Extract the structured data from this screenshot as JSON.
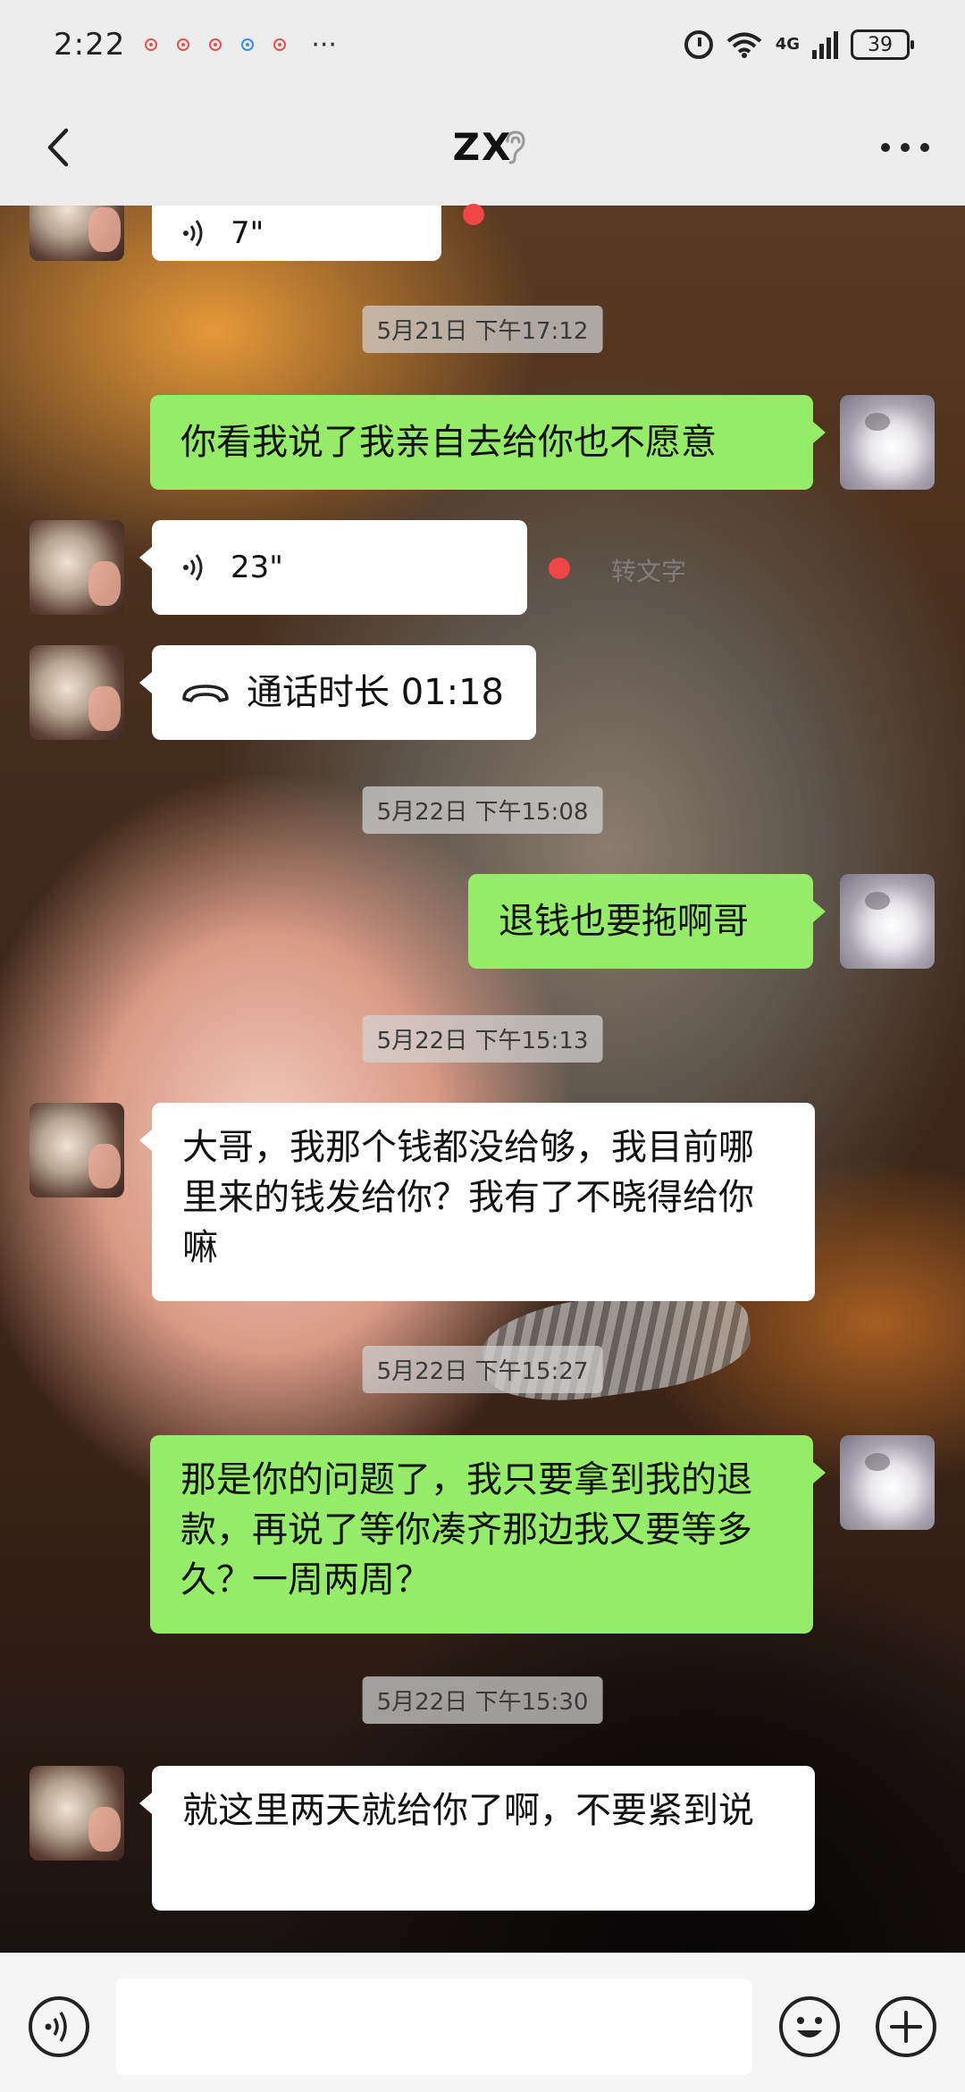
{
  "status_bar": {
    "time": "2:22",
    "more": "···",
    "network": "4G",
    "battery": "39"
  },
  "header": {
    "title": "ZX"
  },
  "messages": [
    {
      "kind": "voice",
      "sender": "other",
      "duration": "7\""
    },
    {
      "kind": "time",
      "text": "5月21日 下午17:12"
    },
    {
      "kind": "text",
      "sender": "self",
      "text": "你看我说了我亲自去给你也不愿意"
    },
    {
      "kind": "voice",
      "sender": "other",
      "duration": "23\"",
      "convert_label": "转文字"
    },
    {
      "kind": "call",
      "sender": "other",
      "text": "通话时长 01:18"
    },
    {
      "kind": "time",
      "text": "5月22日 下午15:08"
    },
    {
      "kind": "text",
      "sender": "self",
      "text": "退钱也要拖啊哥"
    },
    {
      "kind": "time",
      "text": "5月22日 下午15:13"
    },
    {
      "kind": "text",
      "sender": "other",
      "text": "大哥，我那个钱都没给够，我目前哪里来的钱发给你？我有了不晓得给你嘛"
    },
    {
      "kind": "time",
      "text": "5月22日 下午15:27"
    },
    {
      "kind": "text",
      "sender": "self",
      "text": "那是你的问题了，我只要拿到我的退款，再说了等你凑齐那边我又要等多久？一周两周？"
    },
    {
      "kind": "time",
      "text": "5月22日 下午15:30"
    },
    {
      "kind": "text",
      "sender": "other",
      "text": "就这里两天就给你了啊，不要紧到说"
    }
  ],
  "colors": {
    "self_bubble": "#95ec69",
    "other_bubble": "#ffffff",
    "unread": "#f24545",
    "bar_bg": "#ededed"
  }
}
